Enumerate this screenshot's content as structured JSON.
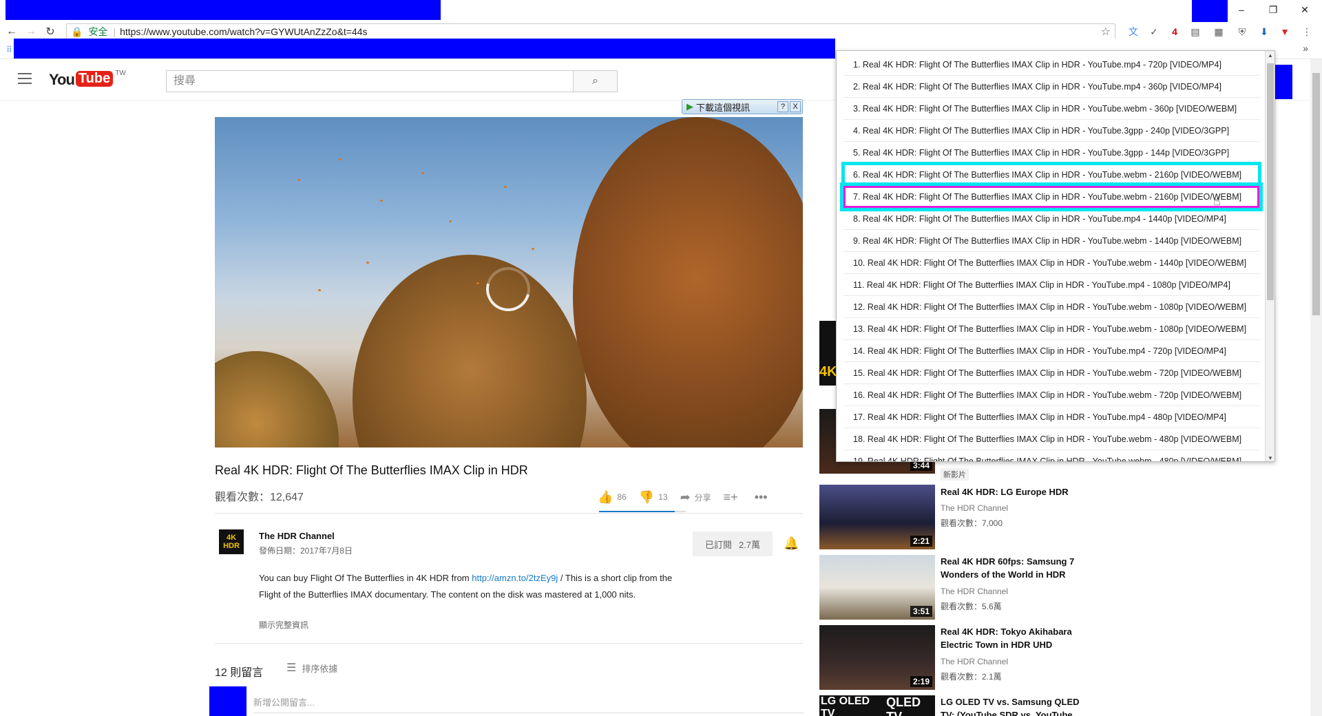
{
  "browser": {
    "window_controls": [
      "–",
      "❐",
      "✕"
    ],
    "secure_label": "安全",
    "url": "https://www.youtube.com/watch?v=GYWUtAnZzZo&t=44s",
    "extension_badge": "42"
  },
  "header": {
    "logo_you": "You",
    "logo_tube": "Tube",
    "logo_region": "TW",
    "search_placeholder": "搜尋"
  },
  "download_widget": {
    "label": "下載這個視訊",
    "help": "?",
    "close": "X"
  },
  "video": {
    "title": "Real 4K HDR: Flight Of The Butterflies IMAX Clip in HDR",
    "views": "觀看次數：12,647",
    "likes": "86",
    "dislikes": "13",
    "share_label": "分享",
    "like_ratio": 0.87
  },
  "channel": {
    "logo_top": "4K",
    "logo_bottom": "HDR",
    "name": "The HDR Channel",
    "published": "發佈日期：2017年7月8日",
    "subscribe_label": "已訂閱",
    "subscriber_count": "2.7萬"
  },
  "description": {
    "text_before": "You can buy Flight Of The Butterflies in 4K HDR from ",
    "link": "http://amzn.to/2tzEy9j",
    "text_after": " / This is a short clip from the Flight of the Butterflies IMAX documentary. The content on the disk was mastered at 1,000 nits.",
    "show_more": "顯示完整資訊"
  },
  "comments": {
    "count": "12 則留言",
    "sort_label": "排序依據",
    "input_placeholder": "新增公開留言..."
  },
  "sidebar": {
    "new_badge": "新影片",
    "items": [
      {
        "title": "Real 4K HDR: LG Europe HDR",
        "channel": "The HDR Channel",
        "views": "觀看次數：7,000",
        "duration": "2:21"
      },
      {
        "title": "Real 4K HDR 60fps: Samsung 7 Wonders of the World in HDR",
        "channel": "The HDR Channel",
        "views": "觀看次數：5.6萬",
        "duration": "3:51"
      },
      {
        "title": "Real 4K HDR: Tokyo Akihabara Electric Town in HDR UHD",
        "channel": "The HDR Channel",
        "views": "觀看次數：2.1萬",
        "duration": "2:19"
      },
      {
        "title": "LG OLED TV vs. Samsung QLED TV: (YouTube SDR vs. YouTube",
        "channel": "",
        "views": "",
        "duration": ""
      }
    ],
    "partial_duration": "3:44",
    "thumb_label_4k": "4K",
    "lg_label": "LG OLED TV",
    "qled_label": "QLED TV"
  },
  "dropdown": {
    "items": [
      "1. Real 4K HDR: Flight Of The Butterflies IMAX Clip in HDR - YouTube.mp4 - 720p [VIDEO/MP4]",
      "2. Real 4K HDR: Flight Of The Butterflies IMAX Clip in HDR - YouTube.mp4 - 360p [VIDEO/MP4]",
      "3. Real 4K HDR: Flight Of The Butterflies IMAX Clip in HDR - YouTube.webm - 360p [VIDEO/WEBM]",
      "4. Real 4K HDR: Flight Of The Butterflies IMAX Clip in HDR - YouTube.3gpp - 240p [VIDEO/3GPP]",
      "5. Real 4K HDR: Flight Of The Butterflies IMAX Clip in HDR - YouTube.3gpp - 144p [VIDEO/3GPP]",
      "6. Real 4K HDR: Flight Of The Butterflies IMAX Clip in HDR - YouTube.webm - 2160p [VIDEO/WEBM]",
      "7. Real 4K HDR: Flight Of The Butterflies IMAX Clip in HDR - YouTube.webm - 2160p [VIDEO/WEBM]",
      "8. Real 4K HDR: Flight Of The Butterflies IMAX Clip in HDR - YouTube.mp4 - 1440p [VIDEO/MP4]",
      "9. Real 4K HDR: Flight Of The Butterflies IMAX Clip in HDR - YouTube.webm - 1440p [VIDEO/WEBM]",
      "10. Real 4K HDR: Flight Of The Butterflies IMAX Clip in HDR - YouTube.webm - 1440p [VIDEO/WEBM]",
      "11. Real 4K HDR: Flight Of The Butterflies IMAX Clip in HDR - YouTube.mp4 - 1080p [VIDEO/MP4]",
      "12. Real 4K HDR: Flight Of The Butterflies IMAX Clip in HDR - YouTube.webm - 1080p [VIDEO/WEBM]",
      "13. Real 4K HDR: Flight Of The Butterflies IMAX Clip in HDR - YouTube.webm - 1080p [VIDEO/WEBM]",
      "14. Real 4K HDR: Flight Of The Butterflies IMAX Clip in HDR - YouTube.mp4 - 720p [VIDEO/MP4]",
      "15. Real 4K HDR: Flight Of The Butterflies IMAX Clip in HDR - YouTube.webm - 720p [VIDEO/WEBM]",
      "16. Real 4K HDR: Flight Of The Butterflies IMAX Clip in HDR - YouTube.webm - 720p [VIDEO/WEBM]",
      "17. Real 4K HDR: Flight Of The Butterflies IMAX Clip in HDR - YouTube.mp4 - 480p [VIDEO/MP4]",
      "18. Real 4K HDR: Flight Of The Butterflies IMAX Clip in HDR - YouTube.webm - 480p [VIDEO/WEBM]",
      "19. Real 4K HDR: Flight Of The Butterflies IMAX Clip in HDR - YouTube.webm - 480p [VIDEO/WEBM]"
    ],
    "highlighted_cyan": 5,
    "highlighted_magenta": 6
  },
  "colors": {
    "redaction": "#0000ff",
    "highlight_cyan": "#00e5ee",
    "highlight_magenta": "#e020e0",
    "brand_red": "#e62117",
    "link_blue": "#167ac6"
  }
}
